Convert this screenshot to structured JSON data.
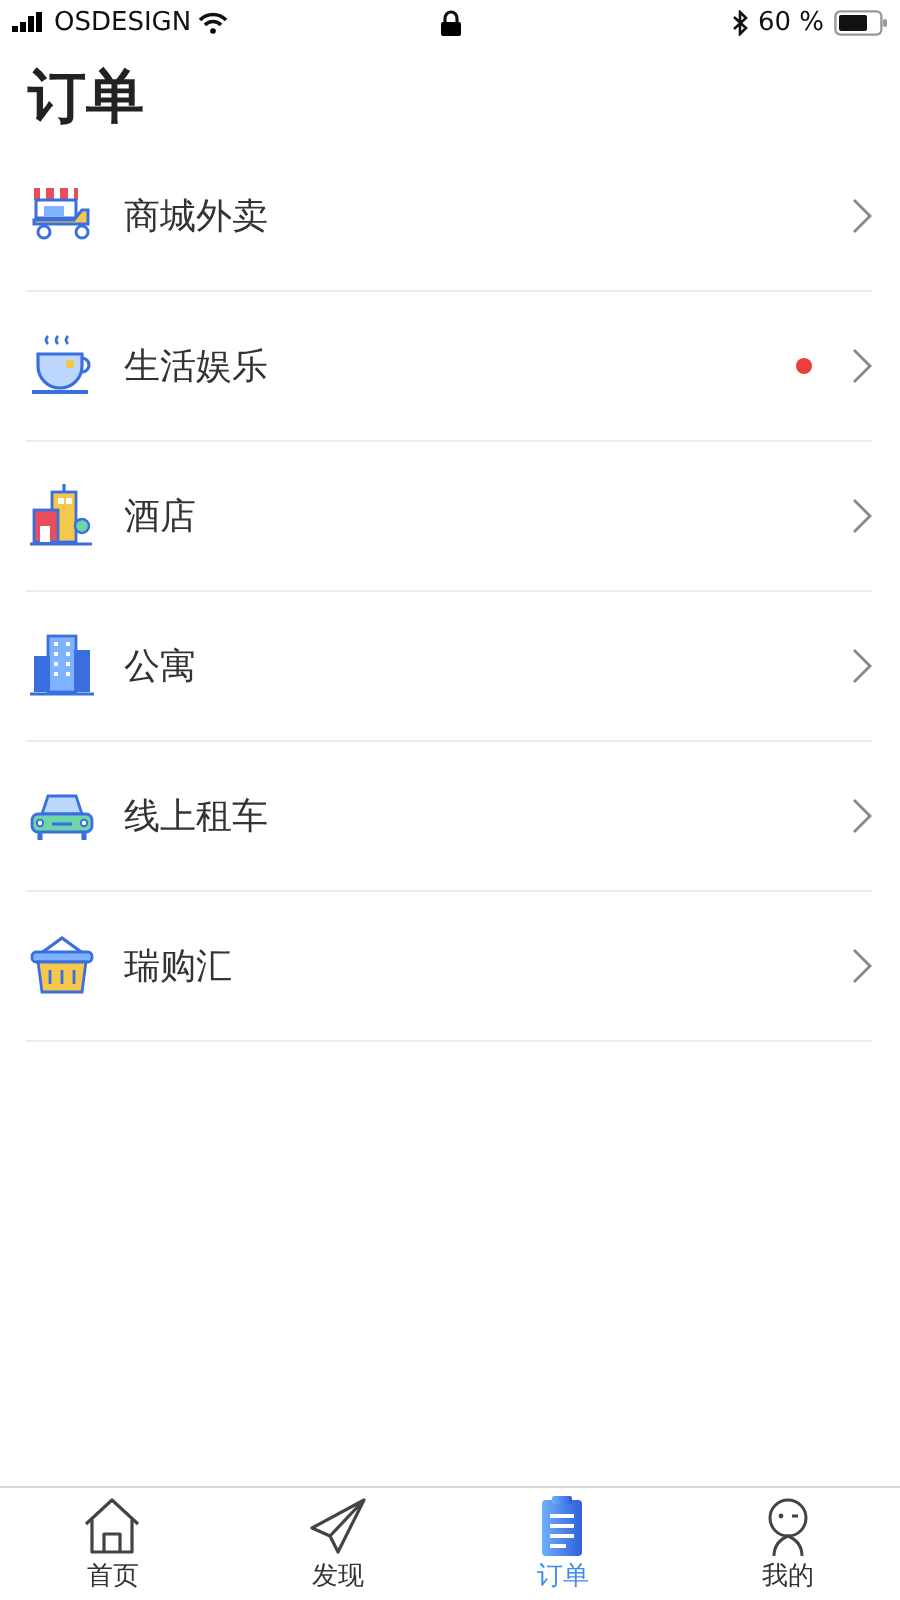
{
  "status_bar": {
    "carrier": "OSDESIGN",
    "battery_text": "60 %"
  },
  "title": "订单",
  "orders": [
    {
      "label": "商城外卖",
      "badge": false
    },
    {
      "label": "生活娱乐",
      "badge": true
    },
    {
      "label": "酒店",
      "badge": false
    },
    {
      "label": "公寓",
      "badge": false
    },
    {
      "label": "线上租车",
      "badge": false
    },
    {
      "label": "瑞购汇",
      "badge": false
    }
  ],
  "tab_bar": [
    {
      "label": "首页",
      "selected": false
    },
    {
      "label": "发现",
      "selected": false
    },
    {
      "label": "订单",
      "selected": true
    },
    {
      "label": "我的",
      "selected": false
    }
  ]
}
